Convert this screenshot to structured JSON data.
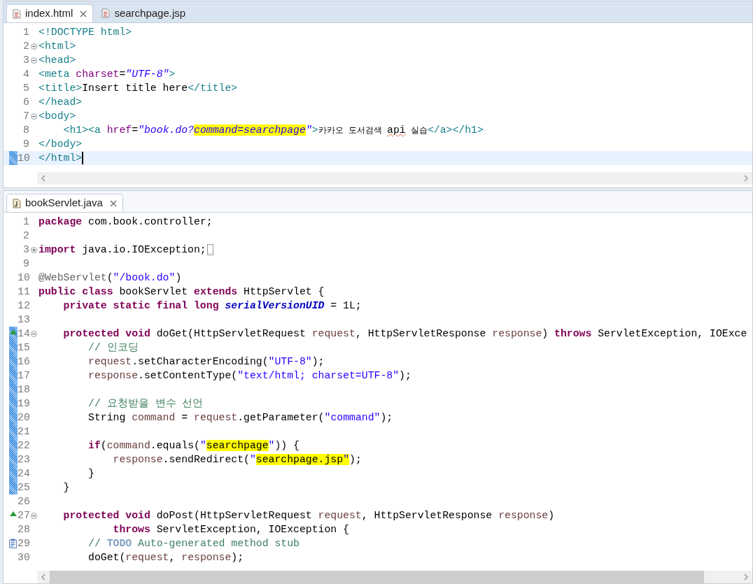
{
  "editors": [
    {
      "tabs": [
        {
          "label": "index.html",
          "kind": "markup",
          "selected": true,
          "closable": true
        },
        {
          "label": "searchpage.jsp",
          "kind": "markup",
          "selected": false,
          "closable": false
        }
      ],
      "scroll_thumb": false,
      "lines": [
        {
          "number": "1",
          "fold_open": false,
          "fold_closed": false,
          "override": false,
          "task": false,
          "changed": false,
          "current": false,
          "folded": false,
          "tokens": [
            {
              "kind": "tag",
              "t": "<!DOCTYPE html>"
            }
          ]
        },
        {
          "number": "2",
          "fold_open": true,
          "fold_closed": false,
          "override": false,
          "task": false,
          "changed": false,
          "current": false,
          "folded": false,
          "tokens": [
            {
              "kind": "tag",
              "t": "<html>"
            }
          ]
        },
        {
          "number": "3",
          "fold_open": true,
          "fold_closed": false,
          "override": false,
          "task": false,
          "changed": false,
          "current": false,
          "folded": false,
          "tokens": [
            {
              "kind": "tag",
              "t": "<head>"
            }
          ]
        },
        {
          "number": "4",
          "fold_open": false,
          "fold_closed": false,
          "override": false,
          "task": false,
          "changed": false,
          "current": false,
          "folded": false,
          "tokens": [
            {
              "kind": "tag",
              "t": "<meta "
            },
            {
              "kind": "attr",
              "t": "charset"
            },
            {
              "kind": "plain",
              "t": "="
            },
            {
              "kind": "istr",
              "t": "\"UTF-8\""
            },
            {
              "kind": "tag",
              "t": ">"
            }
          ]
        },
        {
          "number": "5",
          "fold_open": false,
          "fold_closed": false,
          "override": false,
          "task": false,
          "changed": false,
          "current": false,
          "folded": false,
          "tokens": [
            {
              "kind": "tag",
              "t": "<title>"
            },
            {
              "kind": "plain",
              "t": "Insert title here"
            },
            {
              "kind": "tag",
              "t": "</title>"
            }
          ]
        },
        {
          "number": "6",
          "fold_open": false,
          "fold_closed": false,
          "override": false,
          "task": false,
          "changed": false,
          "current": false,
          "folded": false,
          "tokens": [
            {
              "kind": "tag",
              "t": "</head>"
            }
          ]
        },
        {
          "number": "7",
          "fold_open": true,
          "fold_closed": false,
          "override": false,
          "task": false,
          "changed": false,
          "current": false,
          "folded": false,
          "tokens": [
            {
              "kind": "tag",
              "t": "<body>"
            }
          ]
        },
        {
          "number": "8",
          "fold_open": false,
          "fold_closed": false,
          "override": false,
          "task": false,
          "changed": false,
          "current": false,
          "folded": false,
          "tokens": [
            {
              "kind": "tag",
              "t": "    <h1><a "
            },
            {
              "kind": "attr",
              "t": "href"
            },
            {
              "kind": "plain",
              "t": "="
            },
            {
              "kind": "istr",
              "t": "\"book.do?"
            },
            {
              "kind": "istr",
              "t": "command=searchpage",
              "hl": true
            },
            {
              "kind": "istr",
              "t": "\""
            },
            {
              "kind": "tag",
              "t": ">"
            },
            {
              "kind": "hangul",
              "t": "카카오 도서검색 "
            },
            {
              "kind": "plain",
              "t": "api",
              "misspelled": true
            },
            {
              "kind": "hangul",
              "t": " 실습"
            },
            {
              "kind": "tag",
              "t": "</a></h1>"
            }
          ]
        },
        {
          "number": "9",
          "fold_open": false,
          "fold_closed": false,
          "override": false,
          "task": false,
          "changed": false,
          "current": false,
          "folded": false,
          "tokens": [
            {
              "kind": "tag",
              "t": "</body>"
            }
          ]
        },
        {
          "number": "10",
          "fold_open": false,
          "fold_closed": false,
          "override": false,
          "task": false,
          "changed": true,
          "current": true,
          "folded": false,
          "tokens": [
            {
              "kind": "tag",
              "t": "</html>"
            }
          ]
        }
      ]
    },
    {
      "tabs": [
        {
          "label": "bookServlet.java",
          "kind": "java",
          "selected": true,
          "closable": true
        }
      ],
      "scroll_thumb": true,
      "lines": [
        {
          "number": "1",
          "fold_open": false,
          "fold_closed": false,
          "override": false,
          "task": false,
          "changed": false,
          "current": false,
          "folded": false,
          "tokens": [
            {
              "kind": "kw",
              "t": "package"
            },
            {
              "kind": "plain",
              "t": " com.book.controller;"
            }
          ]
        },
        {
          "number": "2",
          "fold_open": false,
          "fold_closed": false,
          "override": false,
          "task": false,
          "changed": false,
          "current": false,
          "folded": false
        },
        {
          "number": "3",
          "fold_open": false,
          "fold_closed": true,
          "override": false,
          "task": false,
          "changed": false,
          "current": false,
          "folded": true,
          "tokens": [
            {
              "kind": "kw",
              "t": "import"
            },
            {
              "kind": "plain",
              "t": " java.io.IOException;"
            }
          ]
        },
        {
          "number": "9",
          "fold_open": false,
          "fold_closed": false,
          "override": false,
          "task": false,
          "changed": false,
          "current": false,
          "folded": false
        },
        {
          "number": "10",
          "fold_open": false,
          "fold_closed": false,
          "override": false,
          "task": false,
          "changed": false,
          "current": false,
          "folded": false,
          "tokens": [
            {
              "kind": "ann",
              "t": "@WebServlet"
            },
            {
              "kind": "plain",
              "t": "("
            },
            {
              "kind": "str",
              "t": "\"/book.do\""
            },
            {
              "kind": "plain",
              "t": ")"
            }
          ]
        },
        {
          "number": "11",
          "fold_open": false,
          "fold_closed": false,
          "override": false,
          "task": false,
          "changed": false,
          "current": false,
          "folded": false,
          "tokens": [
            {
              "kind": "kw",
              "t": "public class"
            },
            {
              "kind": "plain",
              "t": " bookServlet "
            },
            {
              "kind": "kw",
              "t": "extends"
            },
            {
              "kind": "plain",
              "t": " HttpServlet {"
            }
          ]
        },
        {
          "number": "12",
          "fold_open": false,
          "fold_closed": false,
          "override": false,
          "task": false,
          "changed": false,
          "current": false,
          "folded": false,
          "tokens": [
            {
              "kind": "kw",
              "t": "    private static final long "
            },
            {
              "kind": "field",
              "t": "serialVersionUID"
            },
            {
              "kind": "plain",
              "t": " = 1L;"
            }
          ]
        },
        {
          "number": "13",
          "fold_open": false,
          "fold_closed": false,
          "override": false,
          "task": false,
          "changed": false,
          "current": false,
          "folded": false
        },
        {
          "number": "14",
          "fold_open": true,
          "fold_closed": false,
          "override": true,
          "task": false,
          "changed": true,
          "current": false,
          "folded": false,
          "tokens": [
            {
              "kind": "kw",
              "t": "    protected void"
            },
            {
              "kind": "plain",
              "t": " doGet(HttpServletRequest "
            },
            {
              "kind": "param",
              "t": "request"
            },
            {
              "kind": "plain",
              "t": ", HttpServletResponse "
            },
            {
              "kind": "param",
              "t": "response"
            },
            {
              "kind": "plain",
              "t": ") "
            },
            {
              "kind": "kw",
              "t": "throws"
            },
            {
              "kind": "plain",
              "t": " ServletException, IOExce"
            }
          ]
        },
        {
          "number": "15",
          "fold_open": false,
          "fold_closed": false,
          "override": false,
          "task": false,
          "changed": true,
          "current": false,
          "folded": false,
          "tokens": [
            {
              "kind": "comment",
              "t": "        // 인코딩"
            }
          ]
        },
        {
          "number": "16",
          "fold_open": false,
          "fold_closed": false,
          "override": false,
          "task": false,
          "changed": true,
          "current": false,
          "folded": false,
          "tokens": [
            {
              "kind": "param",
              "t": "        request"
            },
            {
              "kind": "plain",
              "t": ".setCharacterEncoding("
            },
            {
              "kind": "str",
              "t": "\"UTF-8\""
            },
            {
              "kind": "plain",
              "t": ");"
            }
          ]
        },
        {
          "number": "17",
          "fold_open": false,
          "fold_closed": false,
          "override": false,
          "task": false,
          "changed": true,
          "current": false,
          "folded": false,
          "tokens": [
            {
              "kind": "param",
              "t": "        response"
            },
            {
              "kind": "plain",
              "t": ".setContentType("
            },
            {
              "kind": "str",
              "t": "\"text/html; charset=UTF-8\""
            },
            {
              "kind": "plain",
              "t": ");"
            }
          ]
        },
        {
          "number": "18",
          "fold_open": false,
          "fold_closed": false,
          "override": false,
          "task": false,
          "changed": true,
          "current": false,
          "folded": false
        },
        {
          "number": "19",
          "fold_open": false,
          "fold_closed": false,
          "override": false,
          "task": false,
          "changed": true,
          "current": false,
          "folded": false,
          "tokens": [
            {
              "kind": "comment",
              "t": "        // 요청받을 변수 선언"
            }
          ]
        },
        {
          "number": "20",
          "fold_open": false,
          "fold_closed": false,
          "override": false,
          "task": false,
          "changed": true,
          "current": false,
          "folded": false,
          "tokens": [
            {
              "kind": "plain",
              "t": "        String "
            },
            {
              "kind": "param",
              "t": "command"
            },
            {
              "kind": "plain",
              "t": " = "
            },
            {
              "kind": "param",
              "t": "request"
            },
            {
              "kind": "plain",
              "t": ".getParameter("
            },
            {
              "kind": "str",
              "t": "\"command\""
            },
            {
              "kind": "plain",
              "t": ");"
            }
          ]
        },
        {
          "number": "21",
          "fold_open": false,
          "fold_closed": false,
          "override": false,
          "task": false,
          "changed": true,
          "current": false,
          "folded": false
        },
        {
          "number": "22",
          "fold_open": false,
          "fold_closed": false,
          "override": false,
          "task": false,
          "changed": true,
          "current": false,
          "folded": false,
          "tokens": [
            {
              "kind": "kw",
              "t": "        if"
            },
            {
              "kind": "plain",
              "t": "("
            },
            {
              "kind": "param",
              "t": "command"
            },
            {
              "kind": "plain",
              "t": ".equals("
            },
            {
              "kind": "str",
              "t": "\""
            },
            {
              "kind": "plain",
              "t": "searchpage",
              "hl": true
            },
            {
              "kind": "str",
              "t": "\""
            },
            {
              "kind": "plain",
              "t": ")) {"
            }
          ]
        },
        {
          "number": "23",
          "fold_open": false,
          "fold_closed": false,
          "override": false,
          "task": false,
          "changed": true,
          "current": false,
          "folded": false,
          "tokens": [
            {
              "kind": "param",
              "t": "            response"
            },
            {
              "kind": "plain",
              "t": ".sendRedirect("
            },
            {
              "kind": "str",
              "t": "\""
            },
            {
              "kind": "plain",
              "t": "searchpage.jsp",
              "hl": true
            },
            {
              "kind": "str",
              "t": "\"",
              "hl": true
            },
            {
              "kind": "plain",
              "t": ");"
            }
          ]
        },
        {
          "number": "24",
          "fold_open": false,
          "fold_closed": false,
          "override": false,
          "task": false,
          "changed": true,
          "current": false,
          "folded": false,
          "tokens": [
            {
              "kind": "plain",
              "t": "        }"
            }
          ]
        },
        {
          "number": "25",
          "fold_open": false,
          "fold_closed": false,
          "override": false,
          "task": false,
          "changed": true,
          "current": false,
          "folded": false,
          "tokens": [
            {
              "kind": "plain",
              "t": "    }"
            }
          ]
        },
        {
          "number": "26",
          "fold_open": false,
          "fold_closed": false,
          "override": false,
          "task": false,
          "changed": false,
          "current": false,
          "folded": false
        },
        {
          "number": "27",
          "fold_open": true,
          "fold_closed": false,
          "override": true,
          "task": false,
          "changed": false,
          "current": false,
          "folded": false,
          "tokens": [
            {
              "kind": "kw",
              "t": "    protected void"
            },
            {
              "kind": "plain",
              "t": " doPost(HttpServletRequest "
            },
            {
              "kind": "param",
              "t": "request"
            },
            {
              "kind": "plain",
              "t": ", HttpServletResponse "
            },
            {
              "kind": "param",
              "t": "response"
            },
            {
              "kind": "plain",
              "t": ")"
            }
          ]
        },
        {
          "number": "28",
          "fold_open": false,
          "fold_closed": false,
          "override": false,
          "task": false,
          "changed": false,
          "current": false,
          "folded": false,
          "tokens": [
            {
              "kind": "kw",
              "t": "            throws"
            },
            {
              "kind": "plain",
              "t": " ServletException, IOException {"
            }
          ]
        },
        {
          "number": "29",
          "fold_open": false,
          "fold_closed": false,
          "override": false,
          "task": true,
          "changed": false,
          "current": false,
          "folded": false,
          "tokens": [
            {
              "kind": "comment",
              "t": "        // "
            },
            {
              "kind": "todo",
              "t": "TODO"
            },
            {
              "kind": "comment",
              "t": " Auto-generated method stub"
            }
          ]
        },
        {
          "number": "30",
          "fold_open": false,
          "fold_closed": false,
          "override": false,
          "task": false,
          "changed": false,
          "current": false,
          "folded": false,
          "tokens": [
            {
              "kind": "plain",
              "t": "        doGet("
            },
            {
              "kind": "param",
              "t": "request"
            },
            {
              "kind": "plain",
              "t": ", "
            },
            {
              "kind": "param",
              "t": "response"
            },
            {
              "kind": "plain",
              "t": ");"
            }
          ]
        }
      ]
    }
  ]
}
